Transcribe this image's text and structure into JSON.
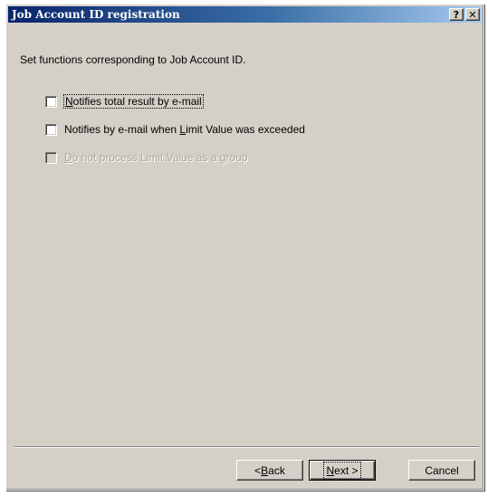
{
  "window": {
    "title": "Job Account ID registration",
    "help_button": "?",
    "close_button": "✕"
  },
  "content": {
    "instruction": "Set functions corresponding to Job Account ID.",
    "options": [
      {
        "pre": "",
        "mnemonic": "N",
        "post": "otifies total result by e-mail",
        "checked": false,
        "enabled": true,
        "focused": true
      },
      {
        "pre": "Notifies by e-mail when ",
        "mnemonic": "L",
        "post": "imit Value was exceeded",
        "checked": false,
        "enabled": true,
        "focused": false
      },
      {
        "pre": "",
        "mnemonic": "D",
        "post": "o not process Limit Value as a group",
        "checked": false,
        "enabled": false,
        "focused": false
      }
    ]
  },
  "buttons": {
    "back": {
      "pre": "< ",
      "mnemonic": "B",
      "post": "ack"
    },
    "next": {
      "pre": "",
      "mnemonic": "N",
      "post": "ext >"
    },
    "cancel": {
      "label": "Cancel"
    }
  }
}
